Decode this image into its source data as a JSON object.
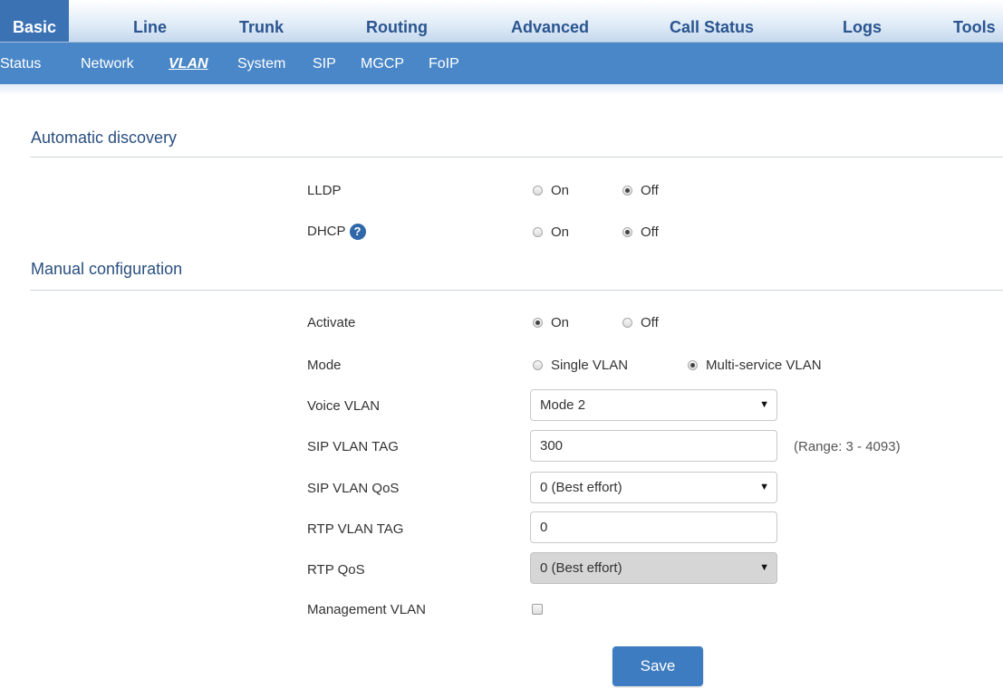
{
  "main_nav": [
    "Basic",
    "Line",
    "Trunk",
    "Routing",
    "Advanced",
    "Call Status",
    "Logs",
    "Tools"
  ],
  "sub_nav": [
    "Status",
    "Network",
    "VLAN",
    "System",
    "SIP",
    "MGCP",
    "FoIP"
  ],
  "auto": {
    "title": "Automatic discovery",
    "lldp": {
      "label": "LLDP",
      "on": "On",
      "off": "Off",
      "selected": "off"
    },
    "dhcp": {
      "label": "DHCP",
      "help": "?",
      "on": "On",
      "off": "Off",
      "selected": "off"
    }
  },
  "manual": {
    "title": "Manual configuration",
    "activate": {
      "label": "Activate",
      "on": "On",
      "off": "Off",
      "selected": "on"
    },
    "mode": {
      "label": "Mode",
      "single": "Single VLAN",
      "multi": "Multi-service VLAN",
      "selected": "multi"
    },
    "voice_vlan": {
      "label": "Voice VLAN",
      "value": "Mode 2"
    },
    "sip_vlan_tag": {
      "label": "SIP VLAN TAG",
      "value": "300",
      "hint": "(Range: 3 - 4093)"
    },
    "sip_vlan_qos": {
      "label": "SIP VLAN QoS",
      "value": "0 (Best effort)"
    },
    "rtp_vlan_tag": {
      "label": "RTP VLAN TAG",
      "value": "0"
    },
    "rtp_qos": {
      "label": "RTP QoS",
      "value": "0 (Best effort)",
      "disabled": true
    },
    "management_vlan": {
      "label": "Management VLAN",
      "checked": false
    }
  },
  "save_label": "Save",
  "colors": {
    "nav_active": "#3a72b4",
    "sub_nav": "#4a87c8",
    "button": "#3d7cc0"
  }
}
